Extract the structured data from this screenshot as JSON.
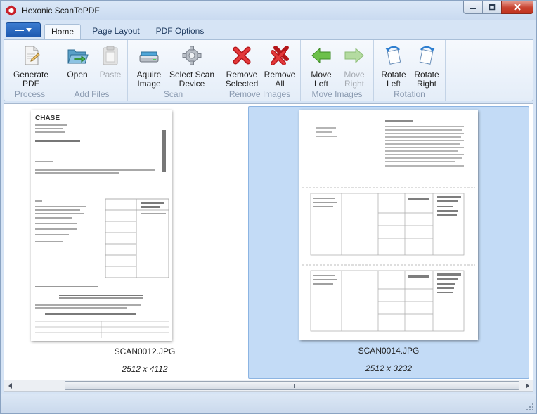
{
  "app": {
    "title": "Hexonic ScanToPDF",
    "brand_color": "#c8202a"
  },
  "window_controls": {
    "minimize": "minimize-icon",
    "maximize": "maximize-icon",
    "close": "close-icon"
  },
  "tabs": [
    {
      "label": "Home",
      "active": true
    },
    {
      "label": "Page Layout",
      "active": false
    },
    {
      "label": "PDF Options",
      "active": false
    }
  ],
  "ribbon": {
    "groups": [
      {
        "label": "Process",
        "buttons": [
          {
            "label": "Generate\nPDF",
            "icon": "generate-pdf-icon",
            "enabled": true
          }
        ]
      },
      {
        "label": "Add Files",
        "buttons": [
          {
            "label": "Open",
            "icon": "folder-open-icon",
            "enabled": true
          },
          {
            "label": "Paste",
            "icon": "paste-icon",
            "enabled": false
          }
        ]
      },
      {
        "label": "Scan",
        "buttons": [
          {
            "label": "Aquire\nImage",
            "icon": "scanner-icon",
            "enabled": true
          },
          {
            "label": "Select Scan\nDevice",
            "icon": "gear-icon",
            "enabled": true
          }
        ]
      },
      {
        "label": "Remove Images",
        "buttons": [
          {
            "label": "Remove\nSelected",
            "icon": "remove-selected-icon",
            "enabled": true
          },
          {
            "label": "Remove\nAll",
            "icon": "remove-all-icon",
            "enabled": true
          }
        ]
      },
      {
        "label": "Move Images",
        "buttons": [
          {
            "label": "Move\nLeft",
            "icon": "arrow-left-icon",
            "enabled": true
          },
          {
            "label": "Move\nRight",
            "icon": "arrow-right-icon",
            "enabled": false
          }
        ]
      },
      {
        "label": "Rotation",
        "buttons": [
          {
            "label": "Rotate\nLeft",
            "icon": "rotate-left-icon",
            "enabled": true
          },
          {
            "label": "Rotate\nRight",
            "icon": "rotate-right-icon",
            "enabled": true
          }
        ]
      }
    ]
  },
  "images": [
    {
      "filename": "SCAN0012.JPG",
      "dimensions": "2512 x 4112",
      "selected": false,
      "header": "CHASE"
    },
    {
      "filename": "SCAN0014.JPG",
      "dimensions": "2512 x 3232",
      "selected": true,
      "header": ""
    }
  ],
  "selection_color": "#c3dbf6"
}
